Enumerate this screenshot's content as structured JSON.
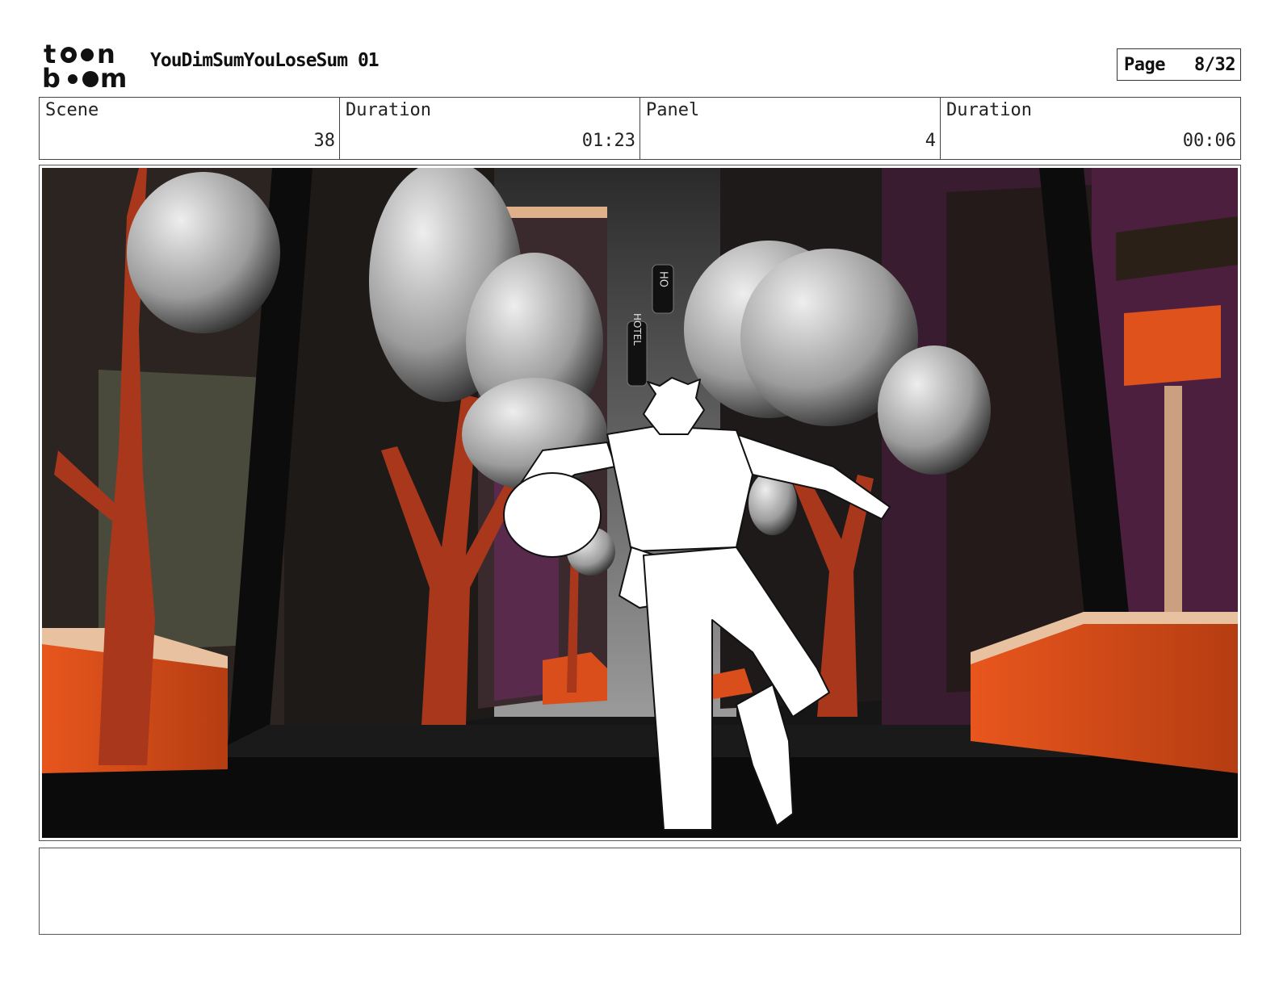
{
  "header": {
    "logo_alt": "toon boom",
    "project_title": "YouDimSumYouLoseSum 01",
    "page_label": "Page",
    "page_number": "8/32"
  },
  "info": [
    {
      "label": "Scene",
      "value": "38"
    },
    {
      "label": "Duration",
      "value": "01:23"
    },
    {
      "label": "Panel",
      "value": "4"
    },
    {
      "label": "Duration",
      "value": "00:06"
    }
  ],
  "panel": {
    "sign_small": "HO",
    "sign_large": "HOTEL"
  },
  "notes": {
    "text": ""
  },
  "colors": {
    "brick": "#a8371c",
    "orange": "#e0521c",
    "purple": "#4a1f3c",
    "dark": "#141414"
  }
}
